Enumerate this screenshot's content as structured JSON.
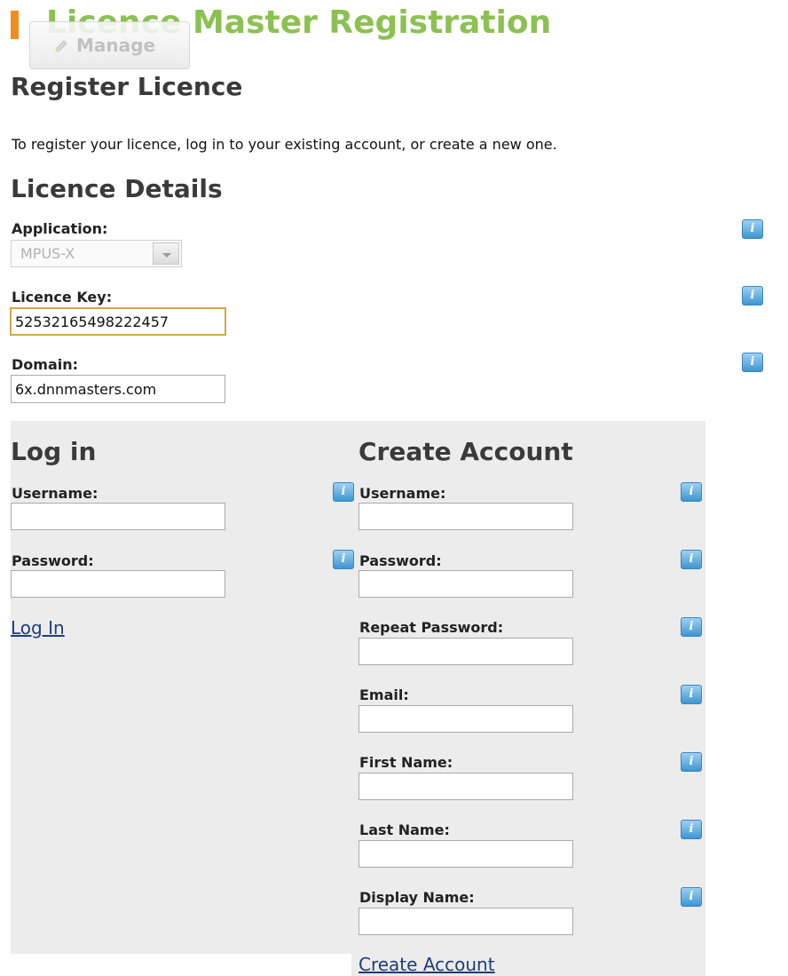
{
  "header": {
    "title": "Licence Master Registration",
    "manage_label": "Manage"
  },
  "page": {
    "heading": "Register Licence",
    "intro": "To register your licence, log in to your existing account, or create a new one."
  },
  "licence": {
    "heading": "Licence Details",
    "application_label": "Application:",
    "application_value": "MPUS-X",
    "key_label": "Licence Key:",
    "key_value": "52532165498222457",
    "domain_label": "Domain:",
    "domain_value": "6x.dnnmasters.com"
  },
  "login": {
    "heading": "Log in",
    "username_label": "Username:",
    "password_label": "Password:",
    "submit_label": "Log In"
  },
  "create": {
    "heading": "Create Account",
    "username_label": "Username:",
    "password_label": "Password:",
    "repeat_password_label": "Repeat Password:",
    "email_label": "Email:",
    "first_name_label": "First Name:",
    "last_name_label": "Last Name:",
    "display_name_label": "Display Name:",
    "submit_label": "Create Account"
  },
  "help_icon_text": "i",
  "colors": {
    "accent_orange": "#f28c1c",
    "title_green": "#8cc152",
    "panel_bg": "#ececec",
    "link_blue": "#1f3d7a"
  }
}
